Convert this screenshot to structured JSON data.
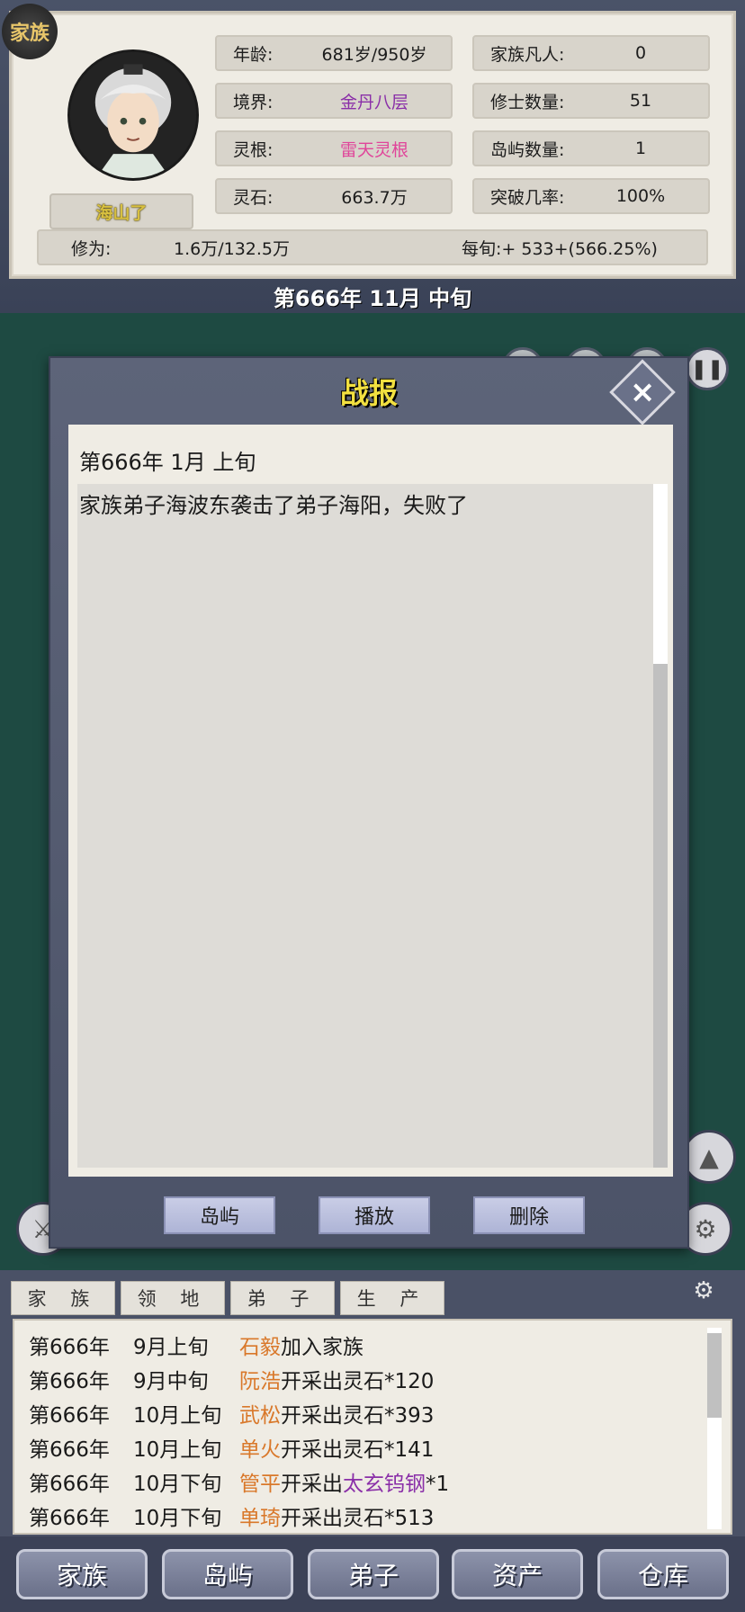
{
  "top": {
    "family_badge": "家族",
    "name": "海山了",
    "stats": {
      "age_label": "年龄:",
      "age_value": "681岁/950岁",
      "realm_label": "境界:",
      "realm_value": "金丹八层",
      "root_label": "灵根:",
      "root_value": "雷天灵根",
      "stones_label": "灵石:",
      "stones_value": "663.7万",
      "mortals_label": "家族凡人:",
      "mortals_value": "0",
      "cultivators_label": "修士数量:",
      "cultivators_value": "51",
      "islands_label": "岛屿数量:",
      "islands_value": "1",
      "breakthrough_label": "突破几率:",
      "breakthrough_value": "100%",
      "cultivation_label": "修为:",
      "cultivation_value": "1.6万/132.5万",
      "per_period": "每旬:+ 533+(566.25%)"
    },
    "date": "第666年 11月 中旬"
  },
  "dialog": {
    "title": "战报",
    "close_icon": "×",
    "report_date": "第666年 1月 上旬",
    "report_text": "家族弟子海波东袭击了弟子海阳，失败了",
    "buttons": {
      "islands": "岛屿",
      "play": "播放",
      "delete": "删除"
    }
  },
  "log": {
    "tabs": [
      "家 族",
      "领 地",
      "弟 子",
      "生 产"
    ],
    "settings_icon": "⚙",
    "entries": [
      {
        "year": "第666年",
        "month": "9月上旬",
        "name": "石毅",
        "action": "加入家族",
        "item": "",
        "count": ""
      },
      {
        "year": "第666年",
        "month": "9月中旬",
        "name": "阮浩",
        "action": "开采出灵石*120",
        "item": "",
        "count": ""
      },
      {
        "year": "第666年",
        "month": "10月上旬",
        "name": "武松",
        "action": "开采出灵石*393",
        "item": "",
        "count": ""
      },
      {
        "year": "第666年",
        "month": "10月上旬",
        "name": "单火",
        "action": "开采出灵石*141",
        "item": "",
        "count": ""
      },
      {
        "year": "第666年",
        "month": "10月下旬",
        "name": "管平",
        "action": "开采出",
        "item": "太玄钨钢",
        "count": "*1"
      },
      {
        "year": "第666年",
        "month": "10月下旬",
        "name": "单琦",
        "action": "开采出灵石*513",
        "item": "",
        "count": ""
      }
    ]
  },
  "nav": {
    "family": "家族",
    "islands": "岛屿",
    "disciples": "弟子",
    "assets": "资产",
    "warehouse": "仓库"
  },
  "colors": {
    "realm": "#8a2fa8",
    "root": "#e0459a",
    "name_highlight": "#d9782a",
    "title": "#f2e040"
  }
}
